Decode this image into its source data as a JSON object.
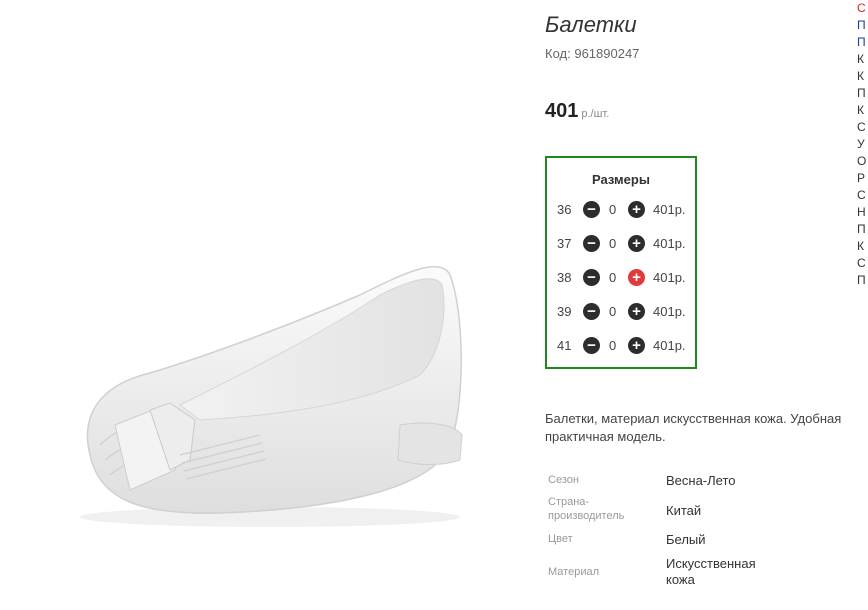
{
  "product": {
    "title": "Балетки",
    "code_label": "Код:",
    "code": "961890247",
    "price": "401",
    "price_unit": "р./шт.",
    "description_line1": "Балетки, материал искусственная кожа. Удобная",
    "description_line2": "практичная модель."
  },
  "sizes": {
    "title": "Размеры",
    "items": [
      {
        "size": "36",
        "qty": "0",
        "price": "401р."
      },
      {
        "size": "37",
        "qty": "0",
        "price": "401р."
      },
      {
        "size": "38",
        "qty": "0",
        "price": "401р."
      },
      {
        "size": "39",
        "qty": "0",
        "price": "401р."
      },
      {
        "size": "41",
        "qty": "0",
        "price": "401р."
      }
    ],
    "minus_icon": "minus-circle-icon",
    "plus_icon": "plus-circle-icon"
  },
  "specs": [
    {
      "key": "Сезон",
      "value": "Весна-Лето"
    },
    {
      "key_line1": "Страна-",
      "key_line2": "производитель",
      "value": "Китай"
    },
    {
      "key": "Цвет",
      "value": "Белый"
    },
    {
      "key": "Материал",
      "value_line1": "Искусственная",
      "value_line2": "кожа"
    }
  ],
  "sidebar_edge": {
    "letters": [
      "С",
      "П",
      "П",
      "К",
      "К",
      "П",
      "К",
      "С",
      "У",
      "О",
      "Р",
      "С",
      "Н",
      "П",
      "К",
      "С",
      "П"
    ]
  },
  "colors": {
    "border_green": "#1e8a1e",
    "active_plus": "#e03a3a",
    "icon_dark": "#2d2d2d"
  }
}
